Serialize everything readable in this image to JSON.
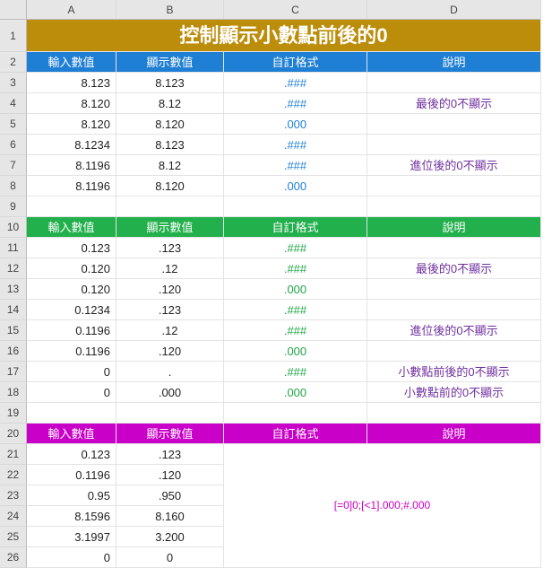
{
  "columns": [
    "A",
    "B",
    "C",
    "D"
  ],
  "rowcount": 26,
  "tallRows": [
    1
  ],
  "title": "控制顯示小數點前後的0",
  "section1": {
    "color": "blue",
    "headers": {
      "A": "輸入數值",
      "B": "顯示數值",
      "C": "自訂格式",
      "D": "說明"
    },
    "rows": [
      {
        "A": "8.123",
        "B": "8.123",
        "C": ".###",
        "D": ""
      },
      {
        "A": "8.120",
        "B": "8.12",
        "C": ".###",
        "D": "最後的0不顯示"
      },
      {
        "A": "8.120",
        "B": "8.120",
        "C": ".000",
        "D": ""
      },
      {
        "A": "8.1234",
        "B": "8.123",
        "C": ".###",
        "D": ""
      },
      {
        "A": "8.1196",
        "B": "8.12",
        "C": ".###",
        "D": "進位後的0不顯示"
      },
      {
        "A": "8.1196",
        "B": "8.120",
        "C": ".000",
        "D": ""
      }
    ]
  },
  "section2": {
    "color": "green",
    "headers": {
      "A": "輸入數值",
      "B": "顯示數值",
      "C": "自訂格式",
      "D": "說明"
    },
    "rows": [
      {
        "A": "0.123",
        "B": ".123",
        "C": ".###",
        "D": ""
      },
      {
        "A": "0.120",
        "B": ".12",
        "C": ".###",
        "D": "最後的0不顯示"
      },
      {
        "A": "0.120",
        "B": ".120",
        "C": ".000",
        "D": ""
      },
      {
        "A": "0.1234",
        "B": ".123",
        "C": ".###",
        "D": ""
      },
      {
        "A": "0.1196",
        "B": ".12",
        "C": ".###",
        "D": "進位後的0不顯示"
      },
      {
        "A": "0.1196",
        "B": ".120",
        "C": ".000",
        "D": ""
      },
      {
        "A": "0",
        "B": ".",
        "C": ".###",
        "D": "小數點前後的0不顯示"
      },
      {
        "A": "0",
        "B": ".000",
        "C": ".000",
        "D": "小數點前的0不顯示"
      }
    ]
  },
  "section3": {
    "color": "mag",
    "headers": {
      "A": "輸入數值",
      "B": "顯示數值",
      "C": "自訂格式",
      "D": "說明"
    },
    "format": "[=0]0;[<1].000;#.000",
    "rows": [
      {
        "A": "0.123",
        "B": ".123"
      },
      {
        "A": "0.1196",
        "B": ".120"
      },
      {
        "A": "0.95",
        "B": ".950"
      },
      {
        "A": "8.1596",
        "B": "8.160"
      },
      {
        "A": "3.1997",
        "B": "3.200"
      },
      {
        "A": "0",
        "B": "0"
      }
    ]
  },
  "chart_data": {
    "type": "table",
    "title": "控制顯示小數點前後的0",
    "sections": [
      {
        "header_color": "#1f7fd4",
        "columns": [
          "輸入數值",
          "顯示數值",
          "自訂格式",
          "說明"
        ],
        "rows": [
          [
            "8.123",
            "8.123",
            ".###",
            ""
          ],
          [
            "8.120",
            "8.12",
            ".###",
            "最後的0不顯示"
          ],
          [
            "8.120",
            "8.120",
            ".000",
            ""
          ],
          [
            "8.1234",
            "8.123",
            ".###",
            ""
          ],
          [
            "8.1196",
            "8.12",
            ".###",
            "進位後的0不顯示"
          ],
          [
            "8.1196",
            "8.120",
            ".000",
            ""
          ]
        ]
      },
      {
        "header_color": "#22b04c",
        "columns": [
          "輸入數值",
          "顯示數值",
          "自訂格式",
          "說明"
        ],
        "rows": [
          [
            "0.123",
            ".123",
            ".###",
            ""
          ],
          [
            "0.120",
            ".12",
            ".###",
            "最後的0不顯示"
          ],
          [
            "0.120",
            ".120",
            ".000",
            ""
          ],
          [
            "0.1234",
            ".123",
            ".###",
            ""
          ],
          [
            "0.1196",
            ".12",
            ".###",
            "進位後的0不顯示"
          ],
          [
            "0.1196",
            ".120",
            ".000",
            ""
          ],
          [
            "0",
            ".",
            ".###",
            "小數點前後的0不顯示"
          ],
          [
            "0",
            ".000",
            ".000",
            "小數點前的0不顯示"
          ]
        ]
      },
      {
        "header_color": "#c800c8",
        "columns": [
          "輸入數值",
          "顯示數值",
          "自訂格式",
          "說明"
        ],
        "merged_format": "[=0]0;[<1].000;#.000",
        "rows": [
          [
            "0.123",
            ".123"
          ],
          [
            "0.1196",
            ".120"
          ],
          [
            "0.95",
            ".950"
          ],
          [
            "8.1596",
            "8.160"
          ],
          [
            "3.1997",
            "3.200"
          ],
          [
            "0",
            "0"
          ]
        ]
      }
    ]
  }
}
